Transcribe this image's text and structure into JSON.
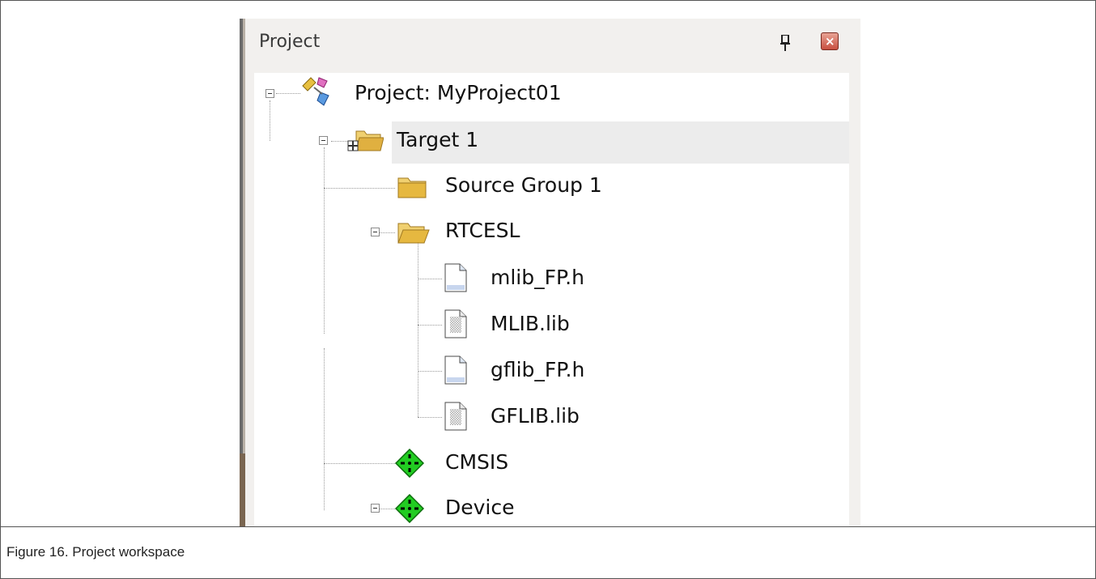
{
  "panel": {
    "title": "Project"
  },
  "tree": {
    "root": {
      "label": "Project: MyProject01",
      "icon": "project-icon"
    },
    "target": {
      "label": "Target 1",
      "icon": "target-folder-icon"
    },
    "source_group": {
      "label": "Source Group 1",
      "icon": "folder-icon"
    },
    "rtcesl": {
      "label": "RTCESL",
      "icon": "open-folder-icon"
    },
    "files": [
      {
        "label": "mlib_FP.h",
        "icon": "header-file-icon"
      },
      {
        "label": "MLIB.lib",
        "icon": "library-file-icon"
      },
      {
        "label": "gflib_FP.h",
        "icon": "header-file-icon"
      },
      {
        "label": "GFLIB.lib",
        "icon": "library-file-icon"
      }
    ],
    "cmsis": {
      "label": "CMSIS",
      "icon": "component-icon"
    },
    "device": {
      "label": "Device",
      "icon": "component-icon"
    }
  },
  "caption": "Figure 16. Project workspace",
  "colors": {
    "highlight": "#ececec",
    "component": "#22cc22",
    "folder": "#e8c25a"
  }
}
